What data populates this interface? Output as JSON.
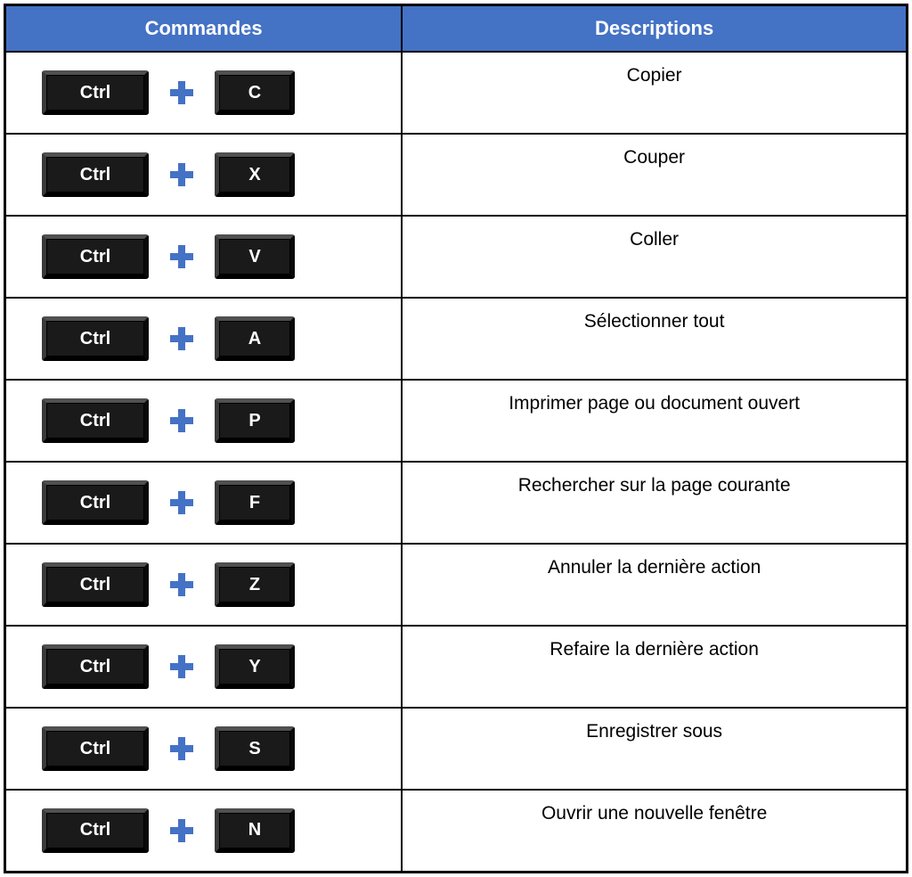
{
  "headers": {
    "commands": "Commandes",
    "descriptions": "Descriptions"
  },
  "modifier_key": "Ctrl",
  "plus_color": "#4472c4",
  "rows": [
    {
      "key": "C",
      "desc": "Copier"
    },
    {
      "key": "X",
      "desc": "Couper"
    },
    {
      "key": "V",
      "desc": "Coller"
    },
    {
      "key": "A",
      "desc": "Sélectionner tout"
    },
    {
      "key": "P",
      "desc": "Imprimer page ou document ouvert"
    },
    {
      "key": "F",
      "desc": "Rechercher sur la page courante"
    },
    {
      "key": "Z",
      "desc": "Annuler la dernière action"
    },
    {
      "key": "Y",
      "desc": "Refaire la dernière action"
    },
    {
      "key": "S",
      "desc": "Enregistrer sous"
    },
    {
      "key": "N",
      "desc": "Ouvrir une nouvelle fenêtre"
    }
  ]
}
